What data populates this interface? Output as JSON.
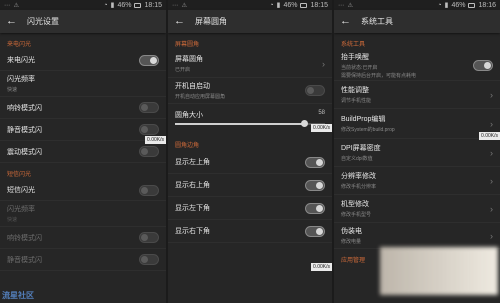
{
  "statusbar": {
    "battery": "46%",
    "time1": "18:15",
    "time2": "18:15",
    "time3": "18:16"
  },
  "panel1": {
    "title": "闪光设置",
    "section1": "来电闪光",
    "rows": [
      {
        "title": "来电闪光"
      },
      {
        "title": "闪光频率",
        "sub": "快速"
      },
      {
        "title": "响铃模式闪"
      },
      {
        "title": "静音模式闪"
      },
      {
        "title": "震动模式闪"
      }
    ],
    "section2": "短信闪光",
    "rows2": [
      {
        "title": "短信闪光"
      },
      {
        "title": "闪光频率",
        "sub": "快速"
      },
      {
        "title": "响铃模式闪"
      },
      {
        "title": "静音模式闪"
      }
    ],
    "speed": "0.00K/s"
  },
  "panel2": {
    "title": "屏幕圆角",
    "section1": "屏幕圆角",
    "rows": [
      {
        "title": "屏幕圆角",
        "sub": "已开启"
      },
      {
        "title": "开机自启动",
        "sub": "开机自动应用屏幕圆角"
      }
    ],
    "slider": {
      "label": "圆角大小",
      "value": "58",
      "fraction": 0.86
    },
    "section2": "圆角边角",
    "rows2": [
      {
        "title": "显示左上角"
      },
      {
        "title": "显示右上角"
      },
      {
        "title": "显示左下角"
      },
      {
        "title": "显示右下角"
      }
    ],
    "speed": "0.00K/s",
    "speed2": "0.00K/s"
  },
  "panel3": {
    "title": "系统工具",
    "section1": "系统工具",
    "rows": [
      {
        "title": "抬手唤醒",
        "sub": "当前状态:已开启",
        "sub2": "需要保持后台开启，可能有点耗电"
      },
      {
        "title": "性能调整",
        "sub": "调节手机性能"
      },
      {
        "title": "BuildProp编辑",
        "sub": "修改System的build.prop"
      },
      {
        "title": "DPI屏幕密度",
        "sub": "自定义dpi数值"
      },
      {
        "title": "分辨率修改",
        "sub": "修改手机分辨率"
      },
      {
        "title": "机型修改",
        "sub": "修改手机型号"
      },
      {
        "title": "伪装电",
        "sub": "修改电量"
      }
    ],
    "section2": "应用管理",
    "speed": "0.00K/s"
  },
  "watermark": "流星社区"
}
